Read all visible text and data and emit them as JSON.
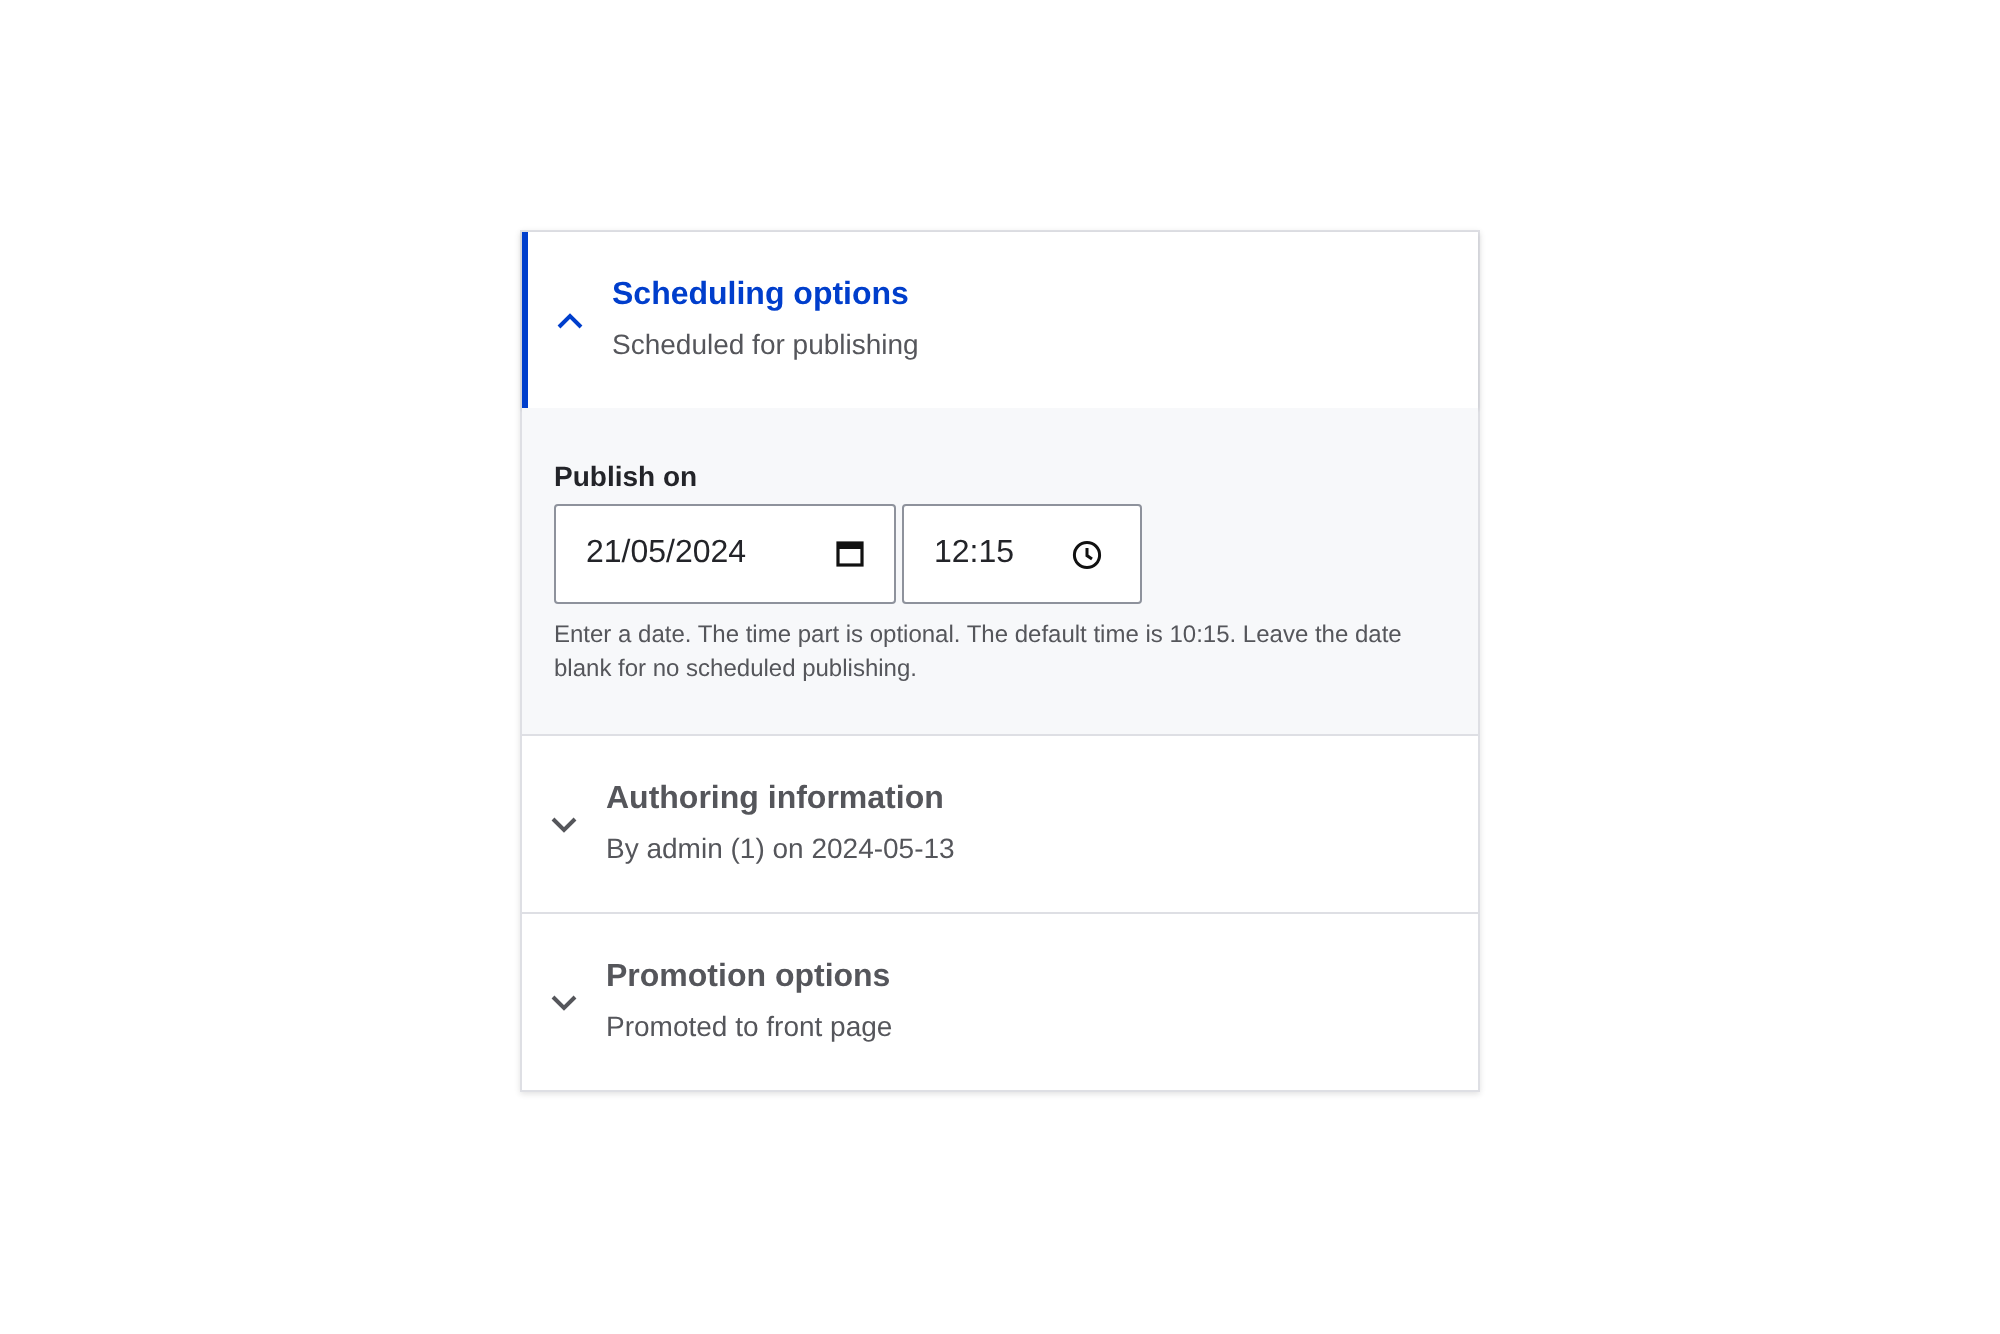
{
  "sections": [
    {
      "title": "Scheduling options",
      "summary": "Scheduled for publishing",
      "expanded": true,
      "content": {
        "label": "Publish on",
        "date": {
          "value": "21/05/2024"
        },
        "time": {
          "value": "12:15"
        },
        "help": "Enter a date. The time part is optional. The default time is 10:15. Leave the date blank for no scheduled publishing."
      }
    },
    {
      "title": "Authoring information",
      "summary": "By admin (1) on 2024-05-13",
      "expanded": false
    },
    {
      "title": "Promotion options",
      "summary": "Promoted to front page",
      "expanded": false
    }
  ]
}
